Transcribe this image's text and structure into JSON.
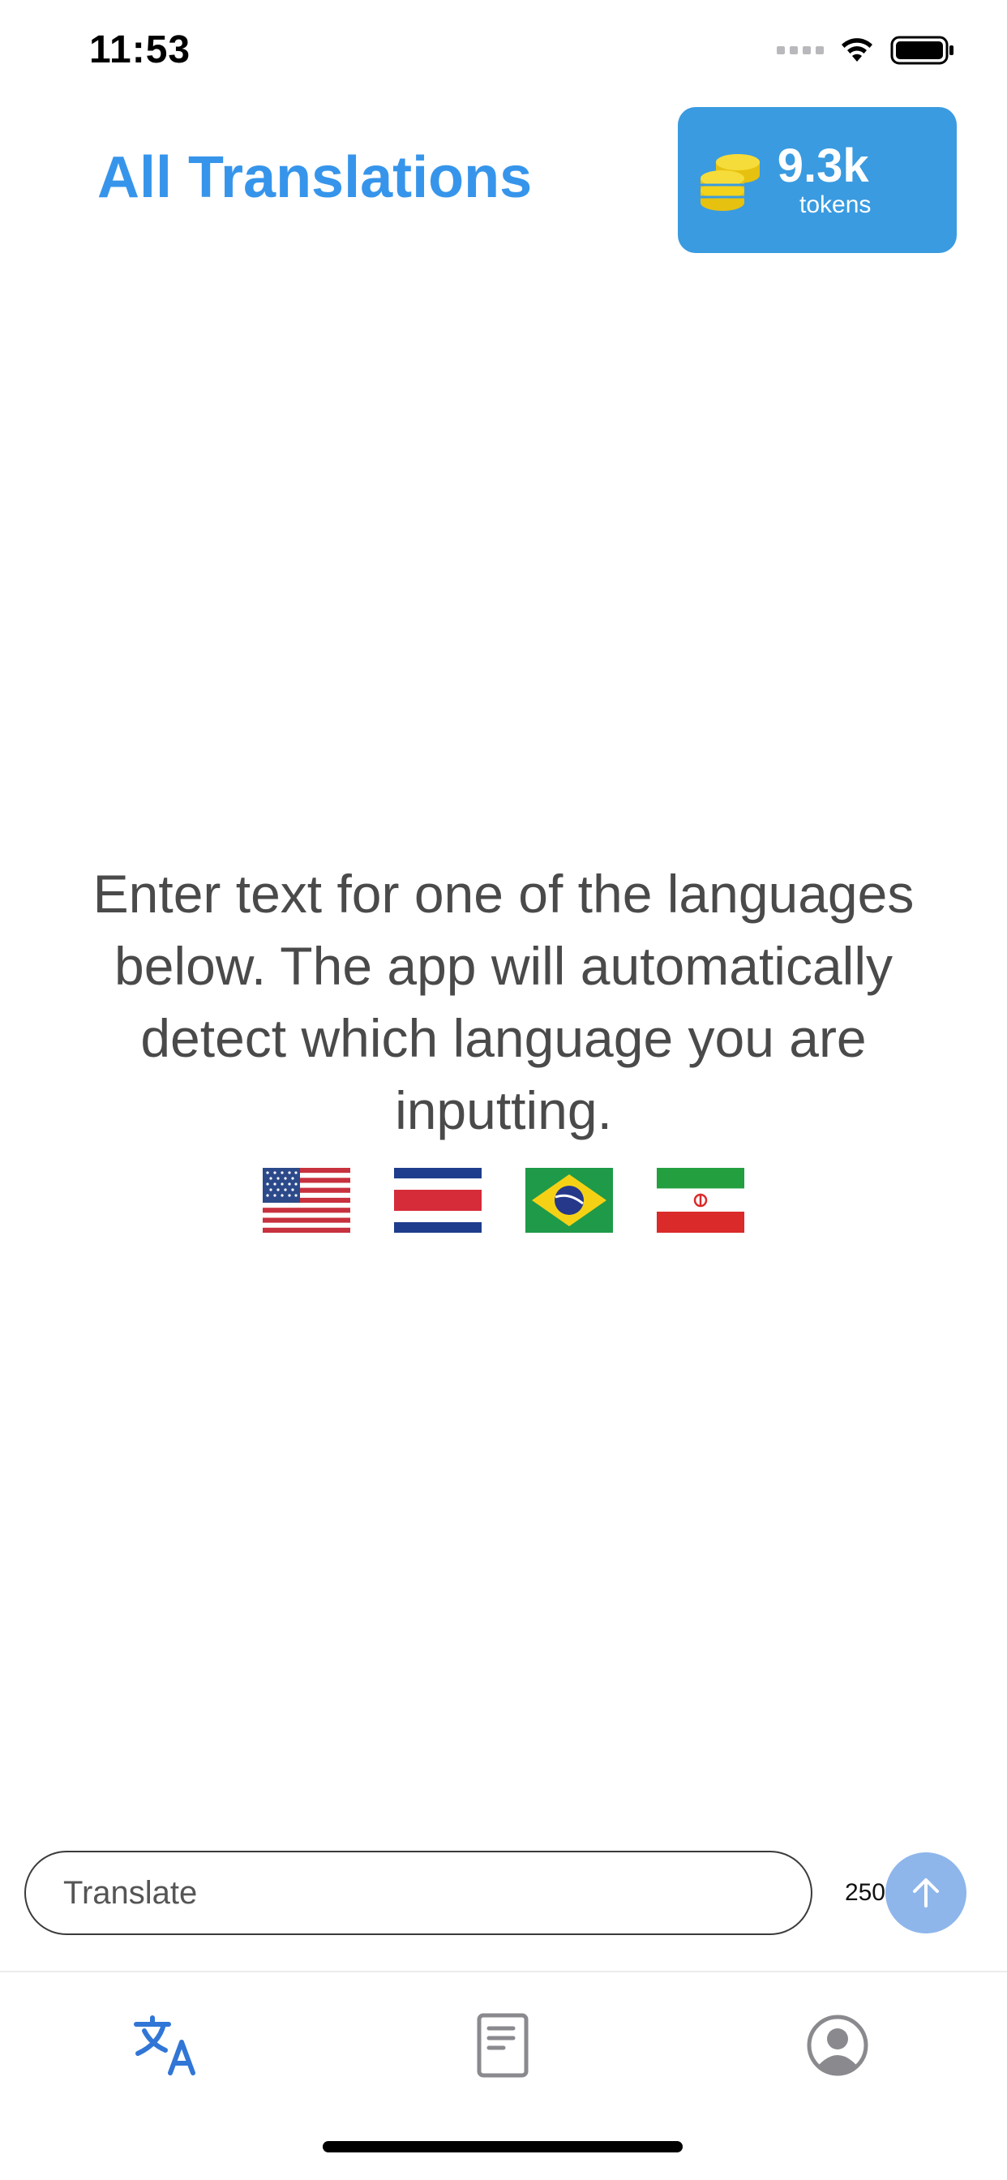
{
  "status_bar": {
    "time": "11:53",
    "icons": [
      "cellular-signal-icon",
      "wifi-icon",
      "battery-icon"
    ]
  },
  "header": {
    "title": "All Translations",
    "tokens": {
      "value": "9.3k",
      "label": "tokens",
      "icon": "coins-icon"
    }
  },
  "main": {
    "instructions": "Enter text for one of the languages below. The app will automatically detect which language you are inputting.",
    "flags": [
      "us-flag-icon",
      "costa-rica-flag-icon",
      "brazil-flag-icon",
      "iran-flag-icon"
    ]
  },
  "composer": {
    "placeholder": "Translate",
    "value": "",
    "char_limit": "250",
    "send_icon": "arrow-up-icon"
  },
  "tab_bar": {
    "tabs": [
      "translate-icon",
      "document-icon",
      "profile-icon"
    ],
    "active": "translate-icon"
  },
  "colors": {
    "accent": "#3695eb",
    "badge_bg": "#3a9be0",
    "coin": "#f3d21b",
    "send_disabled": "#8eb6eb",
    "text": "#4a4a4a"
  }
}
